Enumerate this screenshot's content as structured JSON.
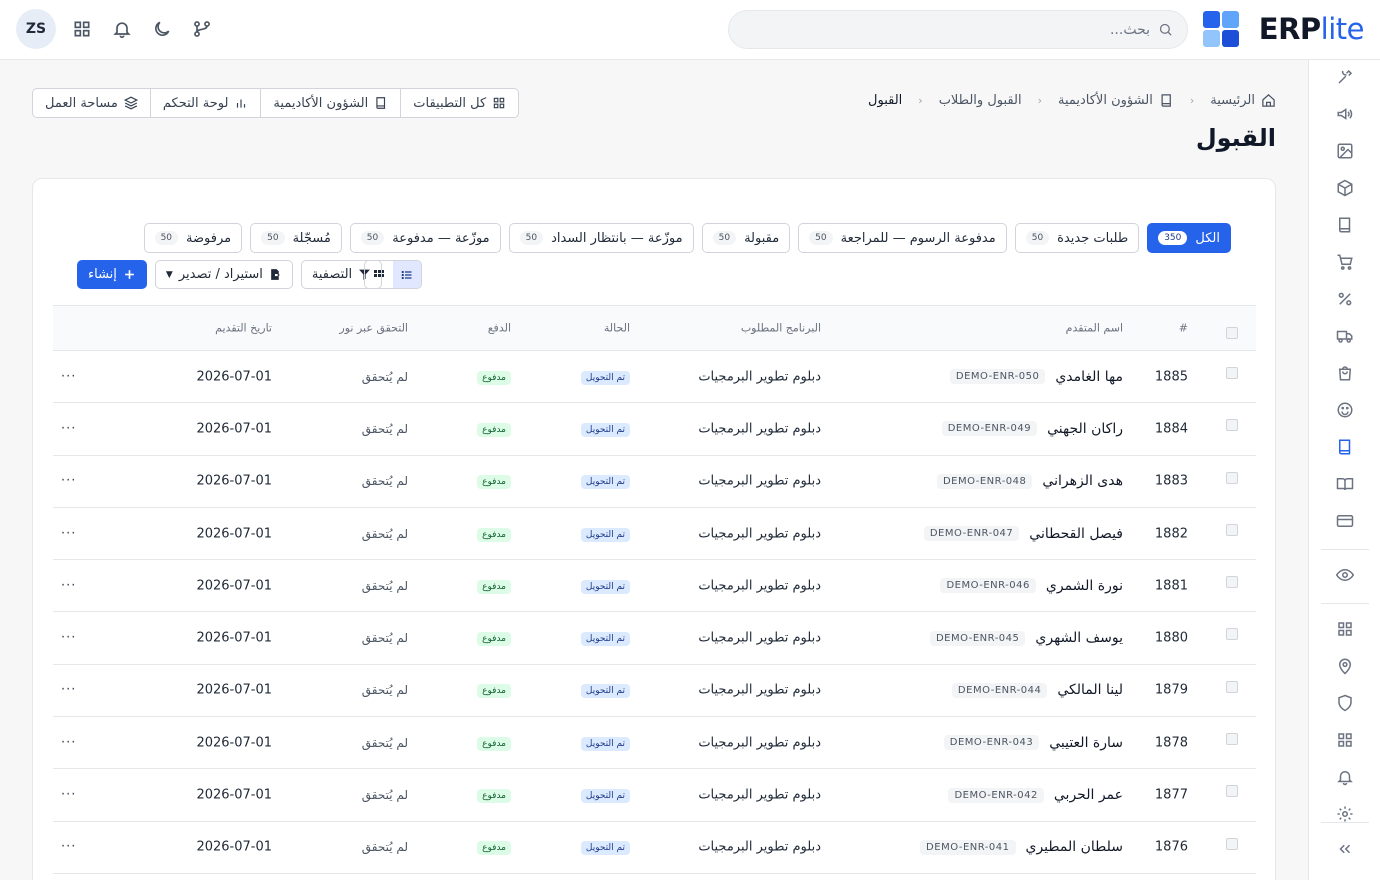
{
  "header": {
    "brand_main": "ERP",
    "brand_accent": "lite",
    "search_placeholder": "بحث...",
    "avatar_initials": "ZS"
  },
  "breadcrumb": [
    {
      "label": "الرئيسية",
      "icon": "home-icon"
    },
    {
      "label": "الشؤون الأكاديمية",
      "icon": "book-icon"
    },
    {
      "label": "القبول والطلاب"
    },
    {
      "label": "القبول"
    }
  ],
  "page_title": "القبول",
  "app_switch": [
    {
      "label": "كل التطبيقات",
      "icon": "apps-grid-icon"
    },
    {
      "label": "الشؤون الأكاديمية",
      "icon": "book-icon"
    },
    {
      "label": "لوحة التحكم",
      "icon": "bar-chart-icon"
    },
    {
      "label": "مساحة العمل",
      "icon": "layers-icon"
    }
  ],
  "tabs": [
    {
      "label": "الكل",
      "count": "350"
    },
    {
      "label": "طلبات جديدة",
      "count": "50"
    },
    {
      "label": "مدفوعة الرسوم — للمراجعة",
      "count": "50"
    },
    {
      "label": "مقبولة",
      "count": "50"
    },
    {
      "label": "موزّعة — بانتظار السداد",
      "count": "50"
    },
    {
      "label": "موزّعة — مدفوعة",
      "count": "50"
    },
    {
      "label": "مُسجّلة",
      "count": "50"
    },
    {
      "label": "مرفوضة",
      "count": "50"
    }
  ],
  "toolbar": {
    "create_label": "إنشاء",
    "import_export_label": "استيراد / تصدير",
    "filter_label": "التصفية"
  },
  "table": {
    "columns": {
      "id": "#",
      "name": "اسم المتقدم",
      "program": "البرنامج المطلوب",
      "status": "الحالة",
      "payment": "الدفع",
      "verify": "التحقق عبر نور",
      "date": "تاريخ التقديم"
    },
    "rows": [
      {
        "id": "1885",
        "name": "مها الغامدي",
        "code": "DEMO-ENR-050",
        "program": "دبلوم تطوير البرمجيات",
        "status": "تم التحويل",
        "payment": "مدفوع",
        "verify": "لم يُتحقق",
        "date": "2026-07-01",
        "more": "···"
      },
      {
        "id": "1884",
        "name": "راكان الجهني",
        "code": "DEMO-ENR-049",
        "program": "دبلوم تطوير البرمجيات",
        "status": "تم التحويل",
        "payment": "مدفوع",
        "verify": "لم يُتحقق",
        "date": "2026-07-01",
        "more": "···"
      },
      {
        "id": "1883",
        "name": "هدى الزهراني",
        "code": "DEMO-ENR-048",
        "program": "دبلوم تطوير البرمجيات",
        "status": "تم التحويل",
        "payment": "مدفوع",
        "verify": "لم يُتحقق",
        "date": "2026-07-01",
        "more": "···"
      },
      {
        "id": "1882",
        "name": "فيصل القحطاني",
        "code": "DEMO-ENR-047",
        "program": "دبلوم تطوير البرمجيات",
        "status": "تم التحويل",
        "payment": "مدفوع",
        "verify": "لم يُتحقق",
        "date": "2026-07-01",
        "more": "···"
      },
      {
        "id": "1881",
        "name": "نورة الشمري",
        "code": "DEMO-ENR-046",
        "program": "دبلوم تطوير البرمجيات",
        "status": "تم التحويل",
        "payment": "مدفوع",
        "verify": "لم يُتحقق",
        "date": "2026-07-01",
        "more": "···"
      },
      {
        "id": "1880",
        "name": "يوسف الشهري",
        "code": "DEMO-ENR-045",
        "program": "دبلوم تطوير البرمجيات",
        "status": "تم التحويل",
        "payment": "مدفوع",
        "verify": "لم يُتحقق",
        "date": "2026-07-01",
        "more": "···"
      },
      {
        "id": "1879",
        "name": "لينا المالكي",
        "code": "DEMO-ENR-044",
        "program": "دبلوم تطوير البرمجيات",
        "status": "تم التحويل",
        "payment": "مدفوع",
        "verify": "لم يُتحقق",
        "date": "2026-07-01",
        "more": "···"
      },
      {
        "id": "1878",
        "name": "سارة العتيبي",
        "code": "DEMO-ENR-043",
        "program": "دبلوم تطوير البرمجيات",
        "status": "تم التحويل",
        "payment": "مدفوع",
        "verify": "لم يُتحقق",
        "date": "2026-07-01",
        "more": "···"
      },
      {
        "id": "1877",
        "name": "عمر الحربي",
        "code": "DEMO-ENR-042",
        "program": "دبلوم تطوير البرمجيات",
        "status": "تم التحويل",
        "payment": "مدفوع",
        "verify": "لم يُتحقق",
        "date": "2026-07-01",
        "more": "···"
      },
      {
        "id": "1876",
        "name": "سلطان المطيري",
        "code": "DEMO-ENR-041",
        "program": "دبلوم تطوير البرمجيات",
        "status": "تم التحويل",
        "payment": "مدفوع",
        "verify": "لم يُتحقق",
        "date": "2026-07-01",
        "more": "···"
      }
    ]
  },
  "sidebar_icons": [
    "tools-icon",
    "megaphone-icon",
    "image-icon",
    "box-icon",
    "book-icon",
    "cart-icon",
    "percent-icon",
    "truck-icon",
    "shopping-bag-icon",
    "smile-icon",
    "book-active-icon",
    "book-open-icon",
    "credit-card-icon",
    "eye-icon",
    "apps-icon",
    "location-icon",
    "shield-icon",
    "apps-icon",
    "bell-icon",
    "settings-icon",
    "collapse-icon"
  ],
  "colors": {
    "accent": "#2563eb",
    "status_bg": "#dbeafe",
    "pay_bg": "#dcfce7"
  }
}
